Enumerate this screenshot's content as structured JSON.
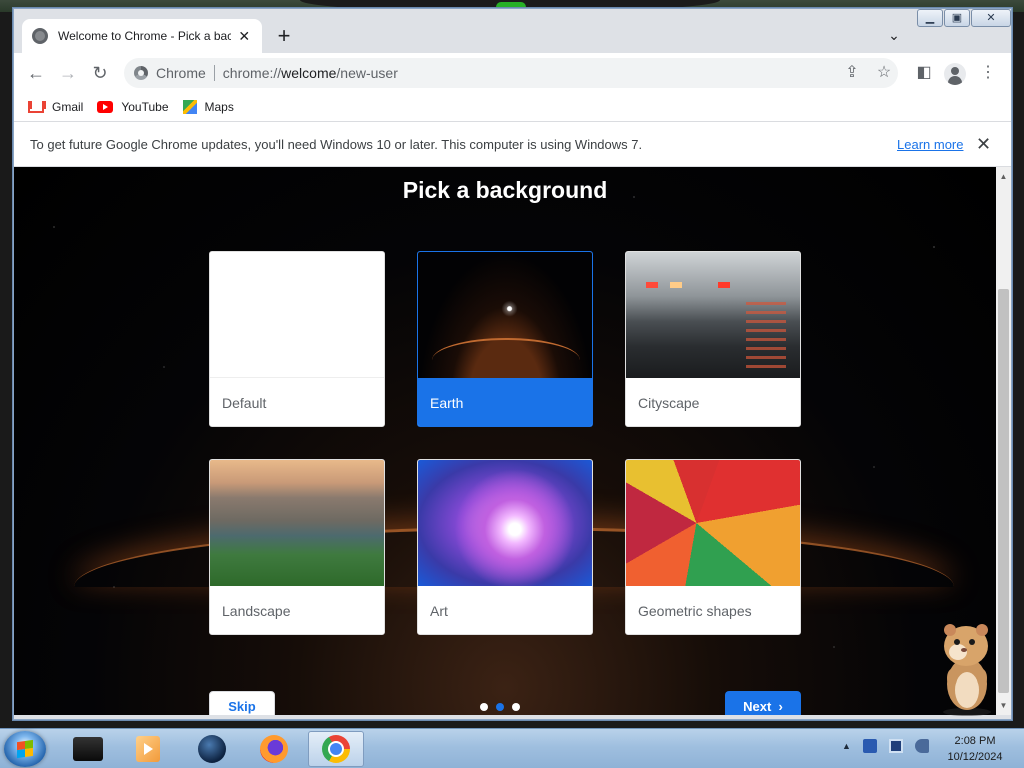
{
  "browser": {
    "tab_title": "Welcome to Chrome - Pick a background",
    "omnibox_site": "Chrome",
    "omnibox_url_prefix": "chrome://",
    "omnibox_url_host": "welcome",
    "omnibox_url_path": "/new-user"
  },
  "bookmarks": [
    {
      "label": "Gmail",
      "icon": "gmail-icon"
    },
    {
      "label": "YouTube",
      "icon": "youtube-icon"
    },
    {
      "label": "Maps",
      "icon": "maps-icon"
    }
  ],
  "infobar": {
    "message": "To get future Google Chrome updates, you'll need Windows 10 or later. This computer is using Windows 7.",
    "learn_more": "Learn more"
  },
  "page": {
    "heading": "Pick a background",
    "backgrounds": [
      {
        "label": "Default",
        "selected": false
      },
      {
        "label": "Earth",
        "selected": true
      },
      {
        "label": "Cityscape",
        "selected": false
      },
      {
        "label": "Landscape",
        "selected": false
      },
      {
        "label": "Art",
        "selected": false
      },
      {
        "label": "Geometric shapes",
        "selected": false
      }
    ],
    "skip_label": "Skip",
    "next_label": "Next",
    "step_current": 2,
    "step_total": 3
  },
  "colors": {
    "accent": "#1a73e8",
    "infobar_link": "#1a73e8"
  },
  "taskbar": {
    "items": [
      "box-app-icon",
      "media-player-icon",
      "globe-app-icon",
      "firefox-icon",
      "chrome-icon"
    ],
    "active_item": "chrome-icon",
    "clock_time": "2:08 PM",
    "clock_date": "10/12/2024"
  }
}
